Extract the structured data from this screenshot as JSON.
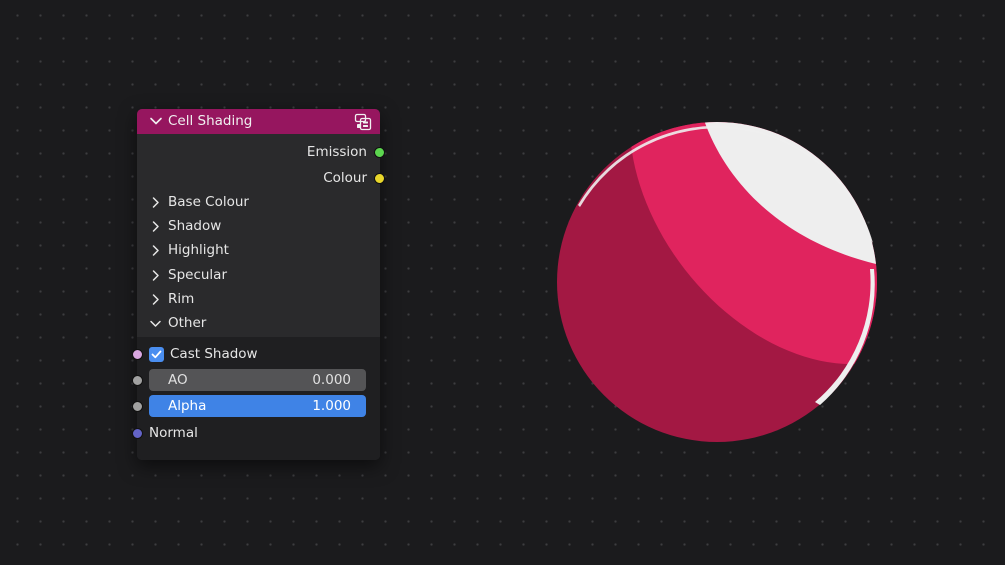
{
  "node": {
    "title": "Cell Shading",
    "header_color": "#96165f",
    "header_icon": "node-group-icon",
    "outputs": [
      {
        "label": "Emission",
        "socket_color": "#5cd64f"
      },
      {
        "label": "Colour",
        "socket_color": "#e8d62b"
      }
    ],
    "panels": [
      {
        "label": "Base Colour",
        "expanded": false
      },
      {
        "label": "Shadow",
        "expanded": false
      },
      {
        "label": "Highlight",
        "expanded": false
      },
      {
        "label": "Specular",
        "expanded": false
      },
      {
        "label": "Rim",
        "expanded": false
      },
      {
        "label": "Other",
        "expanded": true
      }
    ],
    "inputs": {
      "cast_shadow": {
        "label": "Cast Shadow",
        "checked": true,
        "socket_color": "#d9a6e0"
      },
      "ao": {
        "label": "AO",
        "value": "0.000",
        "socket_color": "#a1a1a1"
      },
      "alpha": {
        "label": "Alpha",
        "value": "1.000",
        "socket_color": "#a1a1a1"
      },
      "normal": {
        "label": "Normal",
        "socket_color": "#6363c7"
      }
    }
  },
  "preview": {
    "sphere_color": "#e0245e",
    "shadow_color": "#a31843",
    "highlight_color": "#eeeeee",
    "background_color": "#1b1b1d"
  }
}
